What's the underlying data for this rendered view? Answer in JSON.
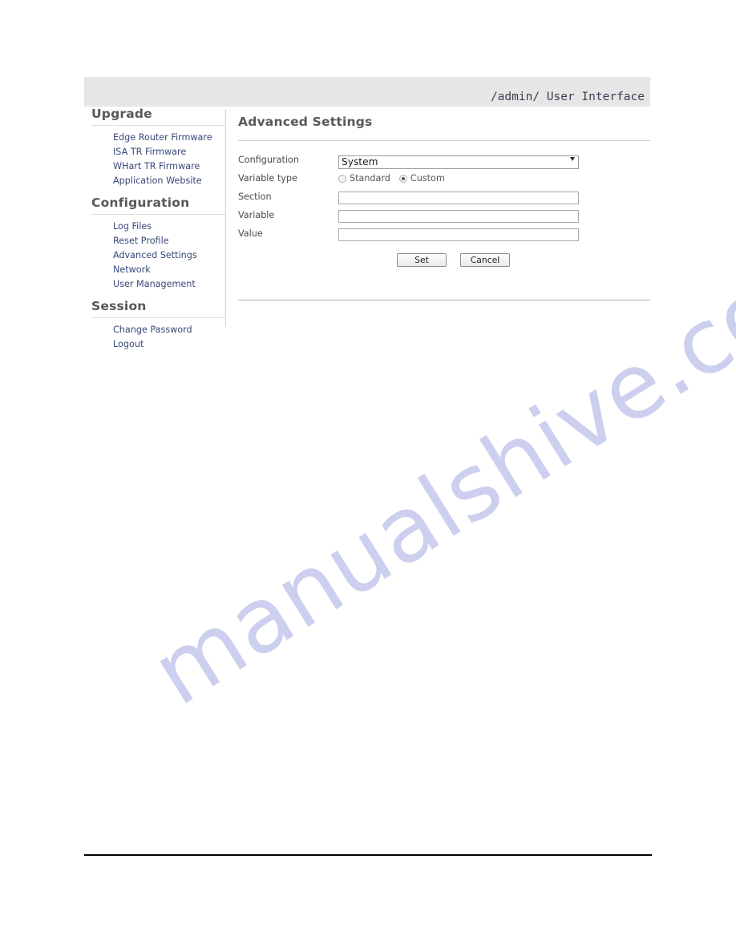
{
  "header": {
    "path": "/admin/ User Interface"
  },
  "watermark": {
    "text": "manualshive.com"
  },
  "sidebar": {
    "groups": [
      {
        "heading": "Upgrade",
        "links": [
          {
            "label": "Edge Router Firmware"
          },
          {
            "label": "ISA TR Firmware"
          },
          {
            "label": "WHart TR Firmware"
          },
          {
            "label": "Application Website"
          }
        ]
      },
      {
        "heading": "Configuration",
        "links": [
          {
            "label": "Log Files"
          },
          {
            "label": "Reset Profile"
          },
          {
            "label": "Advanced Settings"
          },
          {
            "label": "Network"
          },
          {
            "label": "User Management"
          }
        ]
      },
      {
        "heading": "Session",
        "links": [
          {
            "label": "Change Password"
          },
          {
            "label": "Logout"
          }
        ]
      }
    ]
  },
  "content": {
    "title": "Advanced Settings",
    "form": {
      "configuration": {
        "label": "Configuration",
        "selected": "System",
        "options": [
          "System"
        ]
      },
      "variable_type": {
        "label": "Variable type",
        "options": [
          {
            "label": "Standard",
            "selected": false
          },
          {
            "label": "Custom",
            "selected": true
          }
        ]
      },
      "section": {
        "label": "Section",
        "value": "",
        "placeholder": ""
      },
      "variable": {
        "label": "Variable",
        "value": "",
        "placeholder": ""
      },
      "value": {
        "label": "Value",
        "value": "",
        "placeholder": ""
      }
    },
    "buttons": {
      "set": "Set",
      "cancel": "Cancel"
    }
  },
  "colors": {
    "header_bg": "#e6e6e6",
    "link": "#39477a",
    "heading": "#58585c",
    "watermark": "#c9cbee"
  }
}
